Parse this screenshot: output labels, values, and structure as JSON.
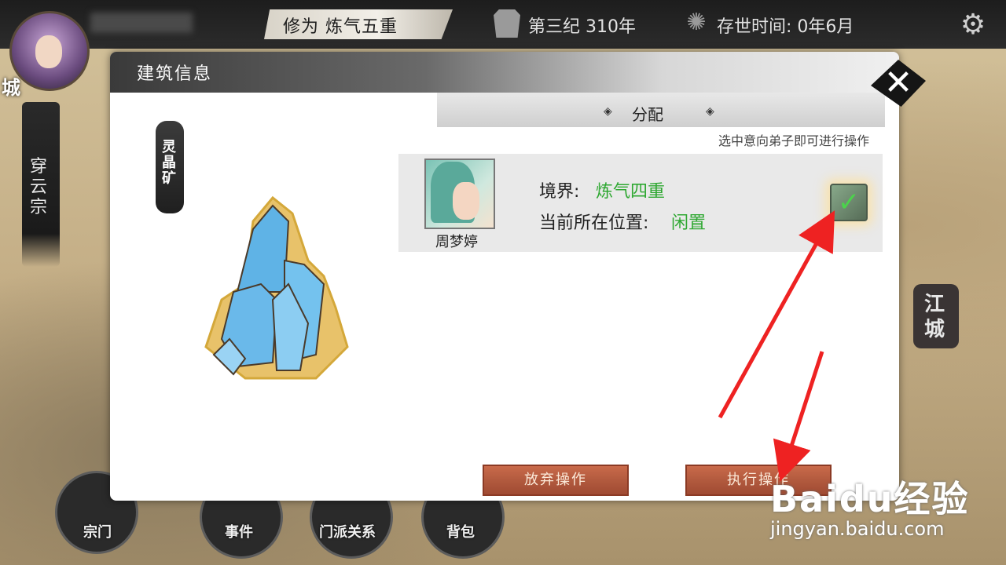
{
  "topbar": {
    "cultivation": "修为  炼气五重",
    "era": "第三纪 310年",
    "survival_time": "存世时间: 0年6月"
  },
  "map": {
    "left_city": "城",
    "sect_name": "穿云宗",
    "right_city": "江城"
  },
  "bottom_nav": [
    {
      "label": "宗门"
    },
    {
      "label": "事件"
    },
    {
      "label": "门派关系"
    },
    {
      "label": "背包"
    }
  ],
  "dialog": {
    "title": "建筑信息",
    "building_name": "灵晶矿",
    "section_title": "分配",
    "hint": "选中意向弟子即可进行操作",
    "disciple": {
      "name": "周梦婷",
      "realm_label": "境界:",
      "realm_value": "炼气四重",
      "location_label": "当前所在位置:",
      "location_value": "闲置",
      "selected": true
    },
    "buttons": {
      "cancel": "放弃操作",
      "execute": "执行操作"
    },
    "colors": {
      "value_green": "#2fa832",
      "button": "#b25a3e"
    }
  },
  "watermark": {
    "brand": "Baidu经验",
    "url": "jingyan.baidu.com"
  }
}
